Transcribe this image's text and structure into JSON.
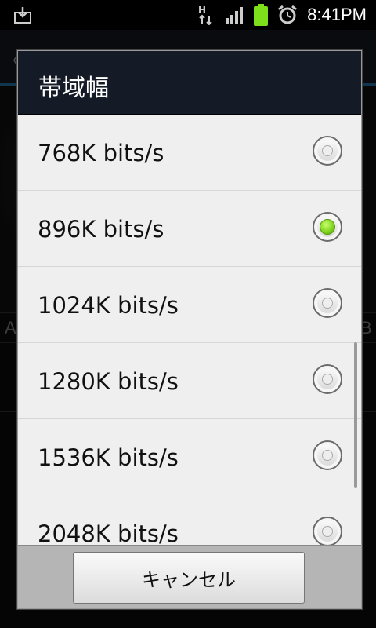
{
  "status_bar": {
    "time": "8:41PM",
    "network_label": "H",
    "icons": [
      "download-icon",
      "network-h-icon",
      "signal-icon",
      "battery-icon",
      "alarm-icon"
    ],
    "battery_color": "#7ee01a"
  },
  "dialog": {
    "title": "帯域幅",
    "options": [
      {
        "label": "768K bits/s",
        "selected": false
      },
      {
        "label": "896K bits/s",
        "selected": true
      },
      {
        "label": "1024K bits/s",
        "selected": false
      },
      {
        "label": "1280K bits/s",
        "selected": false
      },
      {
        "label": "1536K bits/s",
        "selected": false
      },
      {
        "label": "2048K bits/s",
        "selected": false
      }
    ],
    "cancel_label": "キャンセル",
    "accent_color": "#7dd11c",
    "title_bg": "#151b26"
  },
  "background_app": {
    "back_glyph": "〈",
    "letter_a": "A",
    "letter_b": "B"
  }
}
